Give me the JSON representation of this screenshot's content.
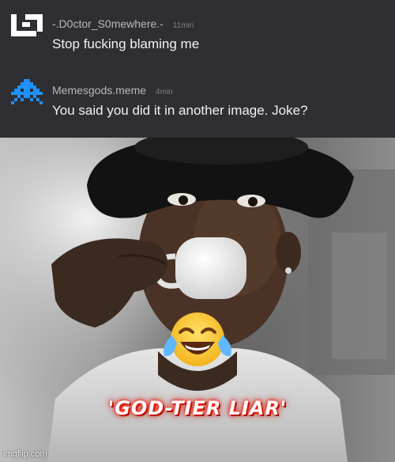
{
  "comments": [
    {
      "username": "-.D0ctor_S0mewhere.-",
      "timestamp": "11min",
      "text": "Stop fucking blaming me",
      "avatar_icon": "bracket-logo-icon"
    },
    {
      "username": "Memesgods.meme",
      "timestamp": "4min",
      "text": "You said you did it in another image. Joke?",
      "avatar_icon": "pixel-invader-icon"
    }
  ],
  "meme": {
    "caption": "'GOD-TIER LIAR'",
    "emoji_icon": "tears-of-joy-emoji-icon",
    "watermark": "imgflip.com"
  },
  "colors": {
    "panel_bg": "#2f2f33",
    "username": "#b9b9bd",
    "comment_text": "#f1f1f3",
    "avatar_accent": "#1e90ff",
    "caption_glow": "#ff2a1a"
  }
}
